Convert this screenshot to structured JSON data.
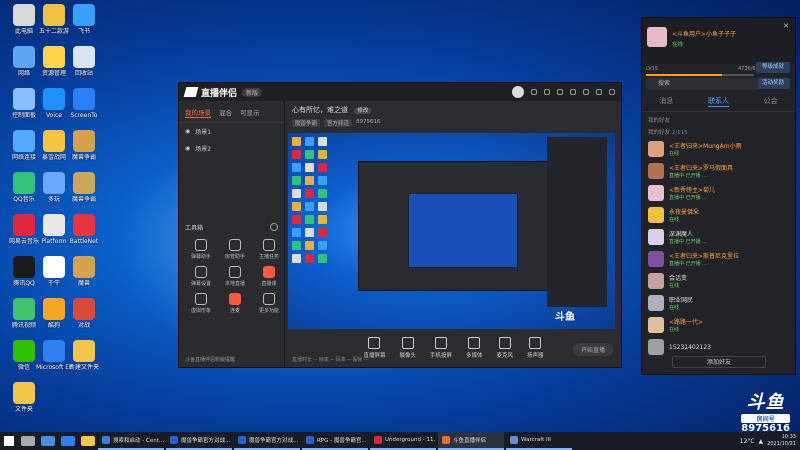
{
  "desktop": {
    "icons": [
      {
        "label": "此电脑",
        "color": "#d9d9d9"
      },
      {
        "label": "五十二款游",
        "color": "#f0c040"
      },
      {
        "label": "飞书",
        "color": "#3aa0ff"
      },
      {
        "label": "网络",
        "color": "#5ca6f0"
      },
      {
        "label": "资源管理",
        "color": "#ffd24a"
      },
      {
        "label": "回收站",
        "color": "#d9e6f2"
      },
      {
        "label": "控制面板",
        "color": "#88c0ff"
      },
      {
        "label": "Voice",
        "color": "#1e90ff"
      },
      {
        "label": "ScreenTo",
        "color": "#2a7fff"
      },
      {
        "label": "网络连接",
        "color": "#55aaff"
      },
      {
        "label": "暴雪战网",
        "color": "#f5c542"
      },
      {
        "label": "魔兽争霸",
        "color": "#d4a24c"
      },
      {
        "label": "QQ音乐",
        "color": "#31c27c"
      },
      {
        "label": "多玩",
        "color": "#6aa8ff"
      },
      {
        "label": "魔兽争霸",
        "color": "#caa55a"
      },
      {
        "label": "网易云音乐",
        "color": "#e0273d"
      },
      {
        "label": "Platform",
        "color": "#e8e8e8"
      },
      {
        "label": "BattleNet",
        "color": "#e8343e"
      },
      {
        "label": "腾讯QQ",
        "color": "#1a1a1a"
      },
      {
        "label": "千牛",
        "color": "#ffffff"
      },
      {
        "label": "魔兽",
        "color": "#d4a24c"
      },
      {
        "label": "腾讯视频",
        "color": "#3fc46b"
      },
      {
        "label": "酷狗",
        "color": "#f6a623"
      },
      {
        "label": "对战",
        "color": "#d94a3a"
      },
      {
        "label": "微信",
        "color": "#2dc100"
      },
      {
        "label": "Microsoft Edge",
        "color": "#2f80ed"
      },
      {
        "label": "新建文件夹",
        "color": "#f3c64a"
      },
      {
        "label": "文件夹",
        "color": "#f3c64a"
      }
    ]
  },
  "app": {
    "title": "直播伴侣",
    "version": "新版",
    "tabs": [
      "我的场景",
      "混合",
      "可显示"
    ],
    "scenes": [
      "场景1",
      "场景2"
    ],
    "room_title": "心有所忆，难之道",
    "room_tag": "修改",
    "room_category": "魔兽争霸",
    "room_sub_pill": "官方频道",
    "room_id": "8975616",
    "tools_header": "工具箱",
    "tools": [
      {
        "label": "弹幕助手",
        "red": false
      },
      {
        "label": "房管助手",
        "red": false
      },
      {
        "label": "主播任务",
        "red": false
      },
      {
        "label": "弹幕设置",
        "red": false
      },
      {
        "label": "本地直播",
        "red": false
      },
      {
        "label": "直播课",
        "red": true
      },
      {
        "label": "虚拟形象",
        "red": false
      },
      {
        "label": "连麦",
        "red": true
      },
      {
        "label": "更多功能",
        "red": false
      }
    ],
    "bottom_note": "斗鱼直播伴侣新版提醒",
    "controls": [
      {
        "label": "直播屏幕"
      },
      {
        "label": "摄像头"
      },
      {
        "label": "手机投屏"
      },
      {
        "label": "多媒体"
      },
      {
        "label": "麦克风"
      },
      {
        "label": "扬声器"
      }
    ],
    "live_button": "开始直播",
    "stats": "直播时长 -- 帧率 -- 码率 -- 丢帧 --"
  },
  "chat": {
    "user_name": "<斗鱼用户>小鱼子子子",
    "user_status": "在线",
    "level_label": "LV15",
    "level_num": "4736/6",
    "level_pct": 0.7,
    "btn1": "等级成就",
    "btn2": "活动奖励",
    "search_placeholder": "搜索",
    "tabs": [
      "消息",
      "联系人",
      "公会"
    ],
    "groups": [
      "我的好友",
      "我的好友 2/115"
    ],
    "friends": [
      {
        "name": "<王者归来>MungAm小雨",
        "status": "在线",
        "color": "#e0a080",
        "orange": true
      },
      {
        "name": "<王者归来>罗马假面具",
        "status": "直播中 已开播 ...",
        "color": "#b07050",
        "orange": true
      },
      {
        "name": "<新秀榜主>菊儿",
        "status": "直播中 已开播 ...",
        "color": "#e8c0d0",
        "orange": true
      },
      {
        "name": "永夜曼佛朵",
        "status": "在线",
        "color": "#f0c040",
        "orange": true
      },
      {
        "name": "深渊魔人",
        "status": "直播中 已开播 ...",
        "color": "#d8d0e8",
        "orange": false
      },
      {
        "name": "<王者归来>斯普尼克里拉",
        "status": "直播中 已开播 ...",
        "color": "#8050a0",
        "orange": true
      },
      {
        "name": "会话变",
        "status": "在线",
        "color": "#c8a0a0",
        "orange": false
      },
      {
        "name": "职业网民",
        "status": "在线",
        "color": "#b0b0c0",
        "orange": false
      },
      {
        "name": "<路路一代>",
        "status": "在线",
        "color": "#e0c0a0",
        "orange": true
      },
      {
        "name": "15231402123",
        "status": "",
        "color": "#a0a0a0",
        "orange": false
      }
    ],
    "add_button": "添加好友"
  },
  "watermark": {
    "logo": "斗鱼",
    "sub": "房间号",
    "room": "8975616"
  },
  "taskbar": {
    "items": [
      {
        "label": "搜索和启动 - Cent...",
        "color": "#3a7be0"
      },
      {
        "label": "魔兽争霸官方对战...",
        "color": "#2a5fd0"
      },
      {
        "label": "魔兽争霸官方对战...",
        "color": "#2a5fd0"
      },
      {
        "label": "RPG - 魔兽争霸官...",
        "color": "#2a5fd0"
      },
      {
        "label": "Underground - 11...",
        "color": "#e02a2a"
      },
      {
        "label": "斗鱼直播伴侣",
        "color": "#ff6b2a"
      },
      {
        "label": "Warcraft III",
        "color": "#6a8fcf"
      }
    ],
    "weather": "12°C",
    "time": "10:33",
    "date": "2021/10/21"
  }
}
